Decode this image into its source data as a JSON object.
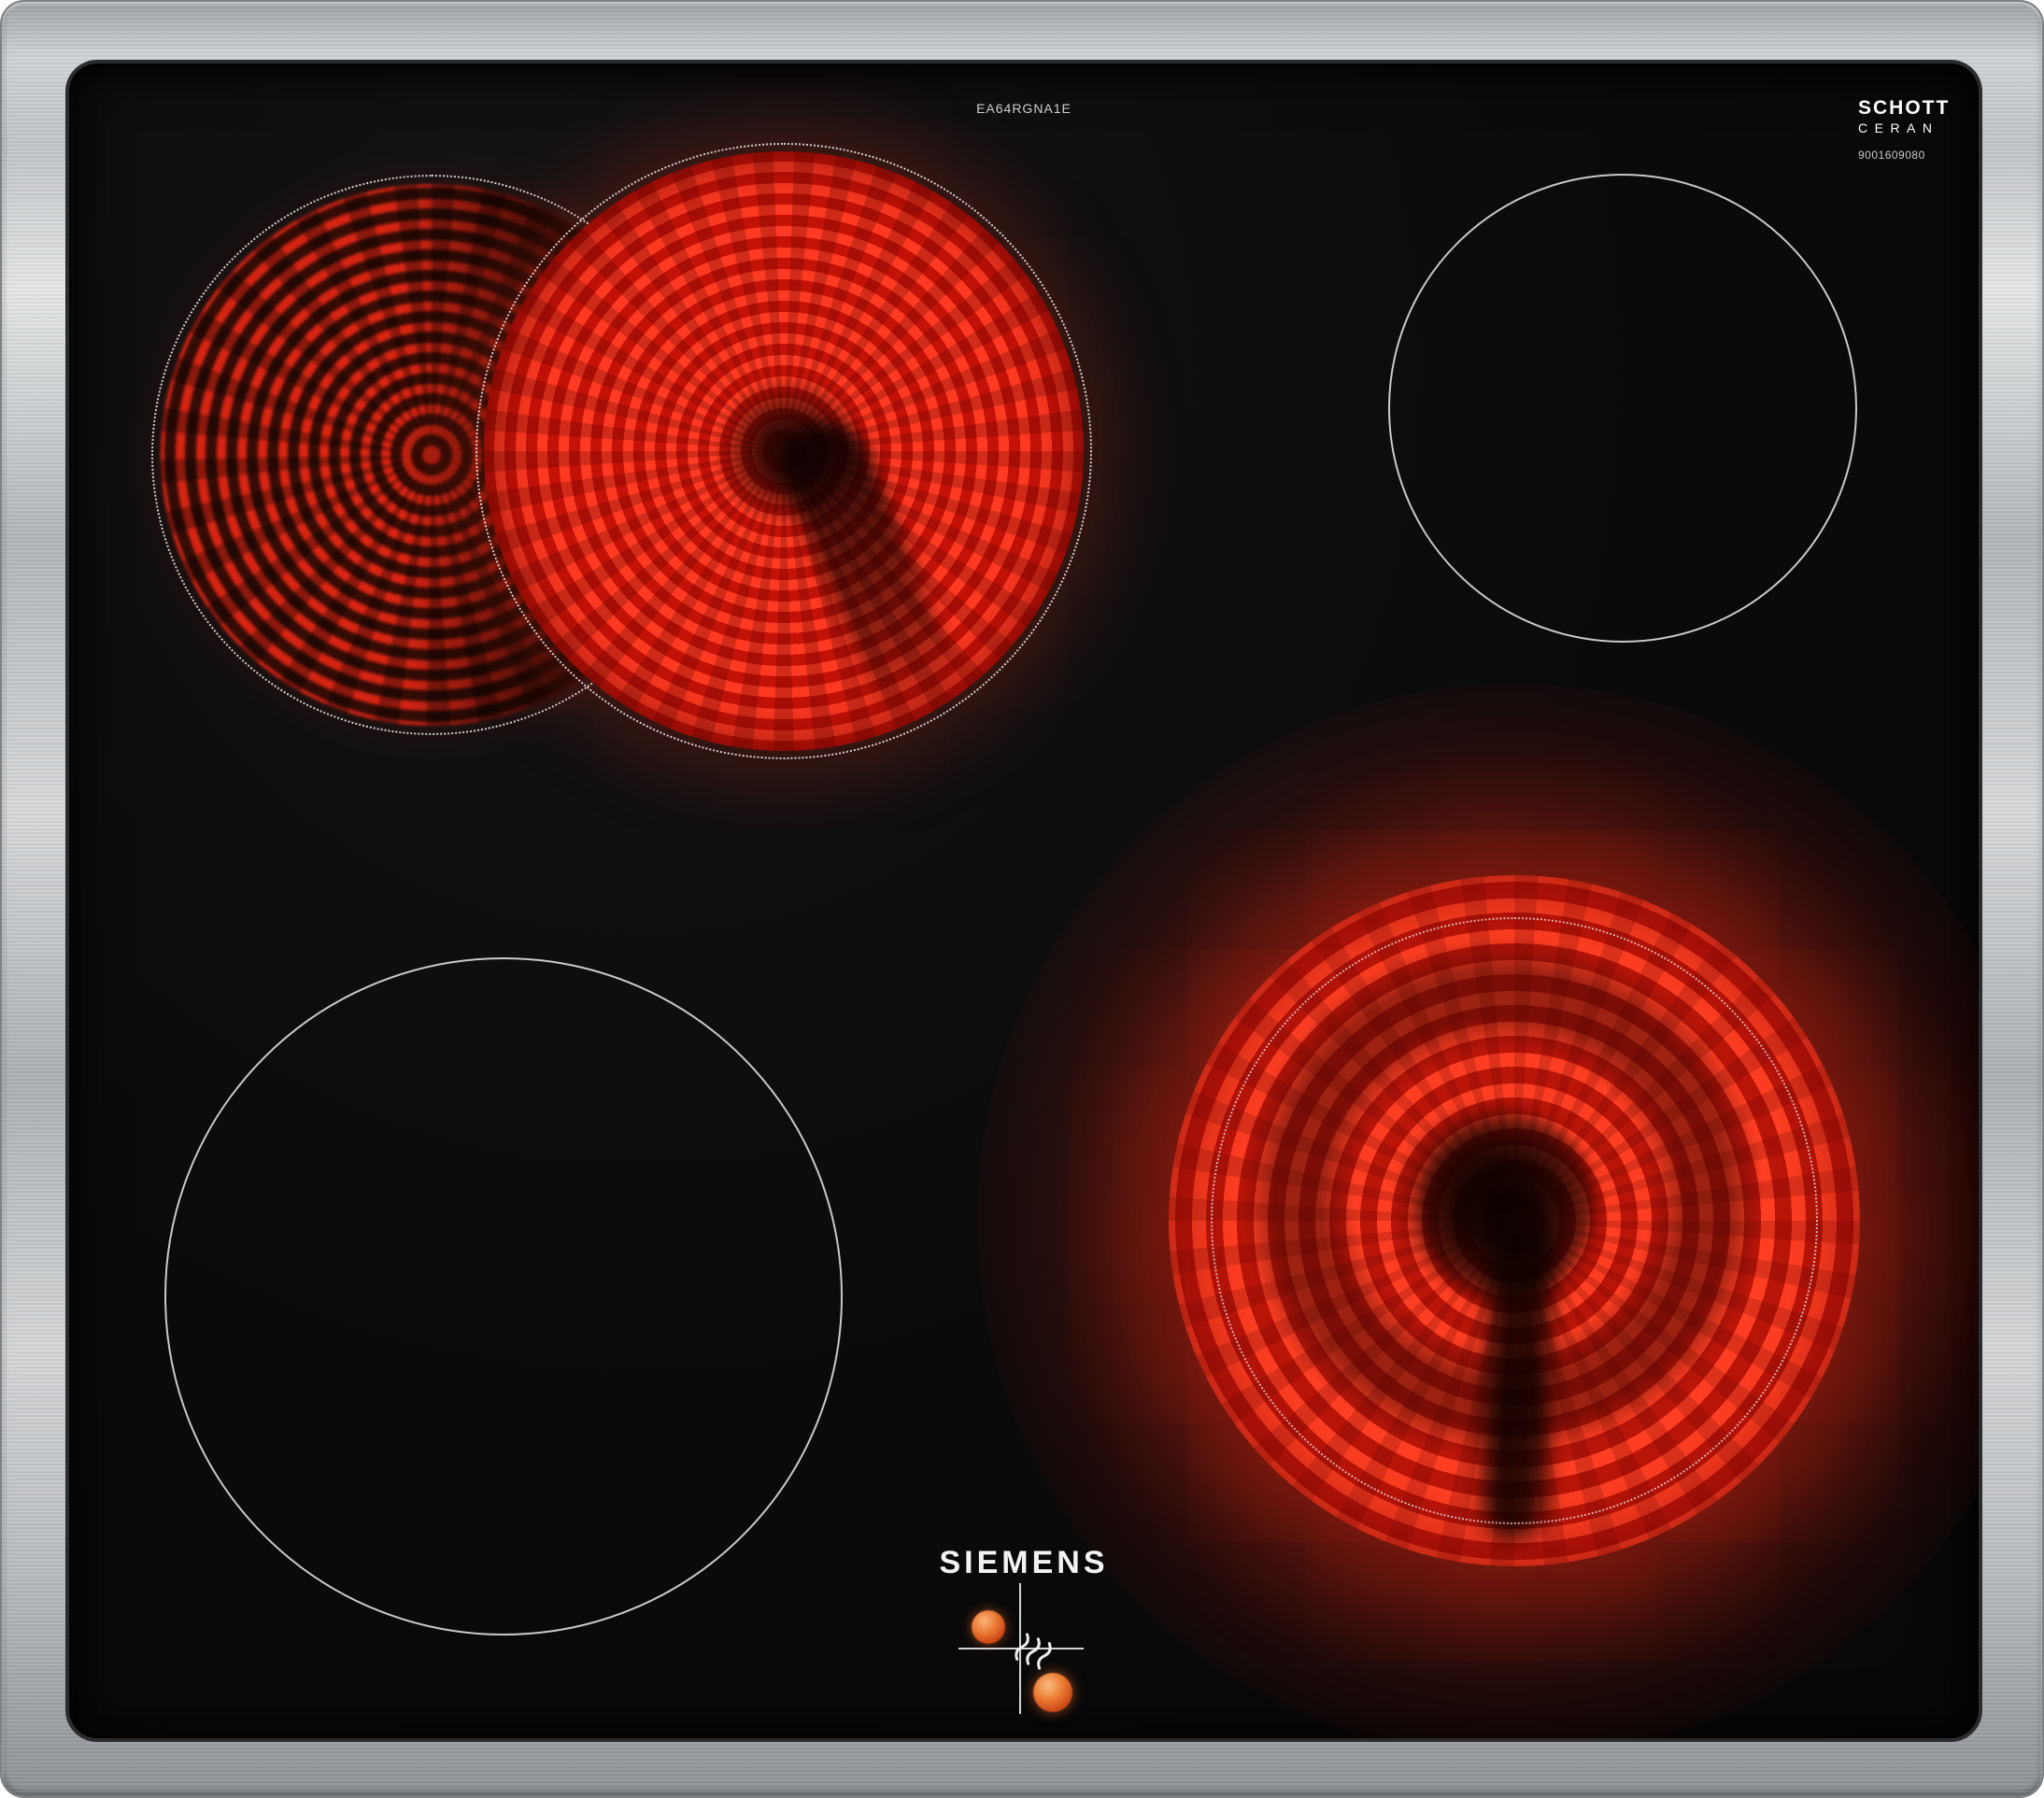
{
  "labels": {
    "brand": "SIEMENS",
    "model": "EA64RGNA1E",
    "glass_brand_line1": "SCHOTT",
    "glass_brand_line2": "CERAN",
    "serial": "9001609080"
  },
  "icons": {
    "heat_waves_icon": "≋",
    "residual_heat_dot": "●"
  },
  "zones": {
    "rear_left": {
      "state": "on",
      "appearance": "dual-circuit radiant element glowing red; main circle bright, extension crescent dimmer, dotted outline markings"
    },
    "rear_right": {
      "state": "off",
      "appearance": "thin white circle marking on black glass"
    },
    "front_left": {
      "state": "off",
      "appearance": "thin white circle marking on black glass"
    },
    "front_right": {
      "state": "on",
      "appearance": "large radiant element glowing red with dark connector shadow in center and dotted outline"
    }
  },
  "controls": {
    "residual_heat_dots": 2,
    "marking": "crosshair alignment lines with heat-waves symbol"
  },
  "colors": {
    "frame_steel": "#c6c9cc",
    "glass_black": "#0a0a0b",
    "glow_red": "#ff3316",
    "marking_white": "#ffffff",
    "indicator_orange": "#e2571f"
  }
}
